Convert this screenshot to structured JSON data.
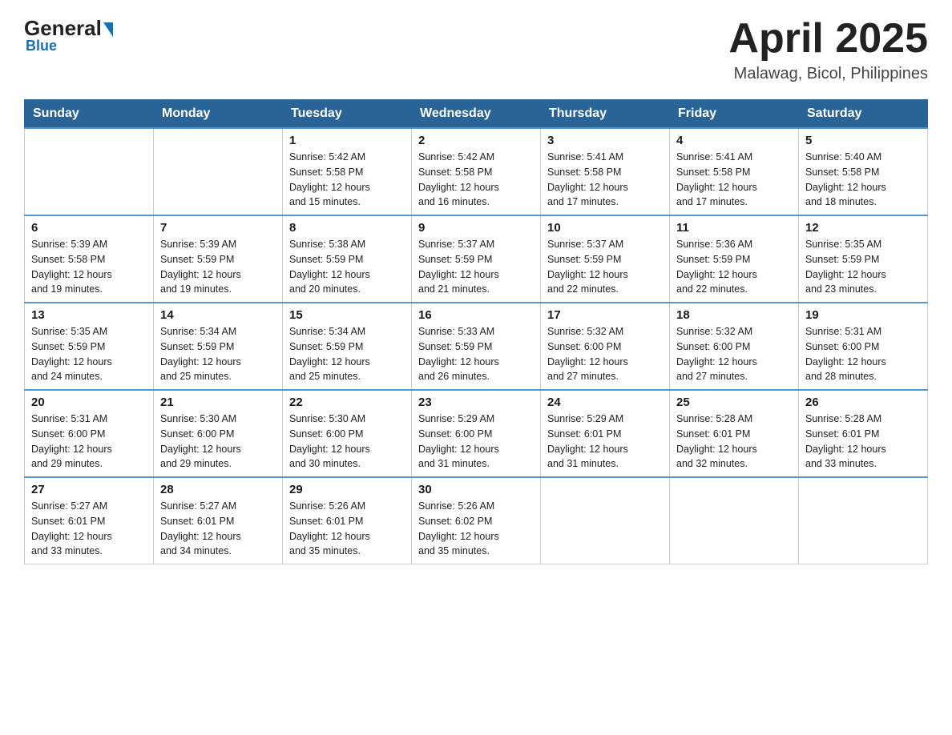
{
  "header": {
    "logo_general": "General",
    "logo_blue": "Blue",
    "month_title": "April 2025",
    "location": "Malawag, Bicol, Philippines"
  },
  "weekdays": [
    "Sunday",
    "Monday",
    "Tuesday",
    "Wednesday",
    "Thursday",
    "Friday",
    "Saturday"
  ],
  "weeks": [
    [
      {
        "day": "",
        "info": ""
      },
      {
        "day": "",
        "info": ""
      },
      {
        "day": "1",
        "info": "Sunrise: 5:42 AM\nSunset: 5:58 PM\nDaylight: 12 hours\nand 15 minutes."
      },
      {
        "day": "2",
        "info": "Sunrise: 5:42 AM\nSunset: 5:58 PM\nDaylight: 12 hours\nand 16 minutes."
      },
      {
        "day": "3",
        "info": "Sunrise: 5:41 AM\nSunset: 5:58 PM\nDaylight: 12 hours\nand 17 minutes."
      },
      {
        "day": "4",
        "info": "Sunrise: 5:41 AM\nSunset: 5:58 PM\nDaylight: 12 hours\nand 17 minutes."
      },
      {
        "day": "5",
        "info": "Sunrise: 5:40 AM\nSunset: 5:58 PM\nDaylight: 12 hours\nand 18 minutes."
      }
    ],
    [
      {
        "day": "6",
        "info": "Sunrise: 5:39 AM\nSunset: 5:58 PM\nDaylight: 12 hours\nand 19 minutes."
      },
      {
        "day": "7",
        "info": "Sunrise: 5:39 AM\nSunset: 5:59 PM\nDaylight: 12 hours\nand 19 minutes."
      },
      {
        "day": "8",
        "info": "Sunrise: 5:38 AM\nSunset: 5:59 PM\nDaylight: 12 hours\nand 20 minutes."
      },
      {
        "day": "9",
        "info": "Sunrise: 5:37 AM\nSunset: 5:59 PM\nDaylight: 12 hours\nand 21 minutes."
      },
      {
        "day": "10",
        "info": "Sunrise: 5:37 AM\nSunset: 5:59 PM\nDaylight: 12 hours\nand 22 minutes."
      },
      {
        "day": "11",
        "info": "Sunrise: 5:36 AM\nSunset: 5:59 PM\nDaylight: 12 hours\nand 22 minutes."
      },
      {
        "day": "12",
        "info": "Sunrise: 5:35 AM\nSunset: 5:59 PM\nDaylight: 12 hours\nand 23 minutes."
      }
    ],
    [
      {
        "day": "13",
        "info": "Sunrise: 5:35 AM\nSunset: 5:59 PM\nDaylight: 12 hours\nand 24 minutes."
      },
      {
        "day": "14",
        "info": "Sunrise: 5:34 AM\nSunset: 5:59 PM\nDaylight: 12 hours\nand 25 minutes."
      },
      {
        "day": "15",
        "info": "Sunrise: 5:34 AM\nSunset: 5:59 PM\nDaylight: 12 hours\nand 25 minutes."
      },
      {
        "day": "16",
        "info": "Sunrise: 5:33 AM\nSunset: 5:59 PM\nDaylight: 12 hours\nand 26 minutes."
      },
      {
        "day": "17",
        "info": "Sunrise: 5:32 AM\nSunset: 6:00 PM\nDaylight: 12 hours\nand 27 minutes."
      },
      {
        "day": "18",
        "info": "Sunrise: 5:32 AM\nSunset: 6:00 PM\nDaylight: 12 hours\nand 27 minutes."
      },
      {
        "day": "19",
        "info": "Sunrise: 5:31 AM\nSunset: 6:00 PM\nDaylight: 12 hours\nand 28 minutes."
      }
    ],
    [
      {
        "day": "20",
        "info": "Sunrise: 5:31 AM\nSunset: 6:00 PM\nDaylight: 12 hours\nand 29 minutes."
      },
      {
        "day": "21",
        "info": "Sunrise: 5:30 AM\nSunset: 6:00 PM\nDaylight: 12 hours\nand 29 minutes."
      },
      {
        "day": "22",
        "info": "Sunrise: 5:30 AM\nSunset: 6:00 PM\nDaylight: 12 hours\nand 30 minutes."
      },
      {
        "day": "23",
        "info": "Sunrise: 5:29 AM\nSunset: 6:00 PM\nDaylight: 12 hours\nand 31 minutes."
      },
      {
        "day": "24",
        "info": "Sunrise: 5:29 AM\nSunset: 6:01 PM\nDaylight: 12 hours\nand 31 minutes."
      },
      {
        "day": "25",
        "info": "Sunrise: 5:28 AM\nSunset: 6:01 PM\nDaylight: 12 hours\nand 32 minutes."
      },
      {
        "day": "26",
        "info": "Sunrise: 5:28 AM\nSunset: 6:01 PM\nDaylight: 12 hours\nand 33 minutes."
      }
    ],
    [
      {
        "day": "27",
        "info": "Sunrise: 5:27 AM\nSunset: 6:01 PM\nDaylight: 12 hours\nand 33 minutes."
      },
      {
        "day": "28",
        "info": "Sunrise: 5:27 AM\nSunset: 6:01 PM\nDaylight: 12 hours\nand 34 minutes."
      },
      {
        "day": "29",
        "info": "Sunrise: 5:26 AM\nSunset: 6:01 PM\nDaylight: 12 hours\nand 35 minutes."
      },
      {
        "day": "30",
        "info": "Sunrise: 5:26 AM\nSunset: 6:02 PM\nDaylight: 12 hours\nand 35 minutes."
      },
      {
        "day": "",
        "info": ""
      },
      {
        "day": "",
        "info": ""
      },
      {
        "day": "",
        "info": ""
      }
    ]
  ]
}
